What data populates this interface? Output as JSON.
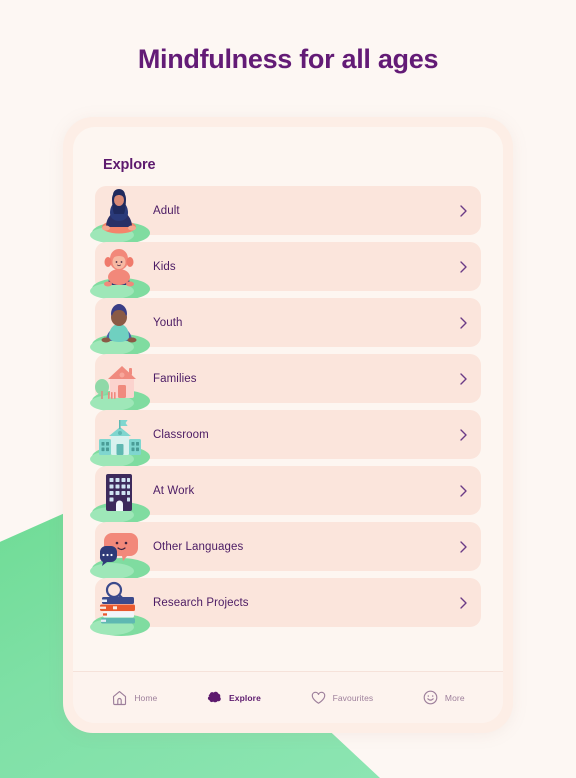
{
  "page": {
    "title": "Mindfulness for all ages",
    "title_color": "#631b76",
    "background_color": "#fdf7f3",
    "accent_green": "#7fe0a6"
  },
  "screen": {
    "section_title": "Explore",
    "card_color": "#fbe5dc",
    "items": [
      {
        "label": "Adult",
        "icon": "meditating-woman-illustration",
        "chevron": "chevron-right-icon"
      },
      {
        "label": "Kids",
        "icon": "meditating-child-illustration",
        "chevron": "chevron-right-icon"
      },
      {
        "label": "Youth",
        "icon": "meditating-youth-illustration",
        "chevron": "chevron-right-icon"
      },
      {
        "label": "Families",
        "icon": "house-illustration",
        "chevron": "chevron-right-icon"
      },
      {
        "label": "Classroom",
        "icon": "school-building-illustration",
        "chevron": "chevron-right-icon"
      },
      {
        "label": "At Work",
        "icon": "office-building-illustration",
        "chevron": "chevron-right-icon"
      },
      {
        "label": "Other Languages",
        "icon": "speech-bubbles-illustration",
        "chevron": "chevron-right-icon"
      },
      {
        "label": "Research Projects",
        "icon": "book-stack-illustration",
        "chevron": "chevron-right-icon"
      }
    ]
  },
  "bottom_nav": {
    "items": [
      {
        "label": "Home",
        "icon": "home-icon",
        "active": false
      },
      {
        "label": "Explore",
        "icon": "brain-icon",
        "active": true
      },
      {
        "label": "Favourites",
        "icon": "heart-icon",
        "active": false
      },
      {
        "label": "More",
        "icon": "smiley-face-icon",
        "active": false
      }
    ]
  }
}
